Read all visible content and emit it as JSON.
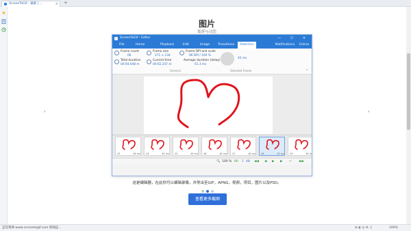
{
  "browser": {
    "tab_title": "ScreenToGif - 录屏 | ...",
    "tab_close": "×",
    "new_tab": "+"
  },
  "sidebar": {
    "icons": [
      "star-icon",
      "page-icon",
      "history-icon"
    ]
  },
  "page": {
    "title": "图片",
    "subtitle": "截屏与动图",
    "prev_arrow": "‹",
    "next_arrow": "›",
    "caption": "这是编辑器，在此你可以编辑录像，并导出至GIF，APNG，视频，项目，图片以及PSD。",
    "dots": [
      false,
      true,
      false
    ],
    "more_button": "查看更多截图"
  },
  "editor": {
    "window_title": "ScreenToGif - Editor",
    "window_buttons": [
      "—",
      "☐",
      "✕"
    ],
    "tabs": [
      "File",
      "Home",
      "Playback",
      "Edit",
      "Image",
      "Transitions",
      "Statistics"
    ],
    "right_tabs": [
      "Notifications",
      "Extras"
    ],
    "active_tab": "Statistics",
    "stats": {
      "frame_count_label": "Frame count",
      "frame_count": "66",
      "total_duration_label": "Total duration",
      "total_duration": "00:04.048 m",
      "frame_size_label": "Frame size",
      "frame_size": "271 × 234",
      "current_time_label": "Current time",
      "current_time": "00:02.247 m",
      "frame_dpi_label": "Frame DPI and scale",
      "frame_dpi": "96 DPI / 100 %",
      "avg_duration_label": "Average duration (delay)",
      "avg_duration": "61.3 ms",
      "selected_delay": "45 ms",
      "group_general": "General",
      "group_selected": "Selected Frame"
    },
    "frames": [
      {
        "index": "43",
        "delay": "46 ms",
        "selected": false
      },
      {
        "index": "44",
        "delay": "45 ms",
        "selected": false
      },
      {
        "index": "45",
        "delay": "46 ms",
        "selected": false
      },
      {
        "index": "46",
        "delay": "46 ms",
        "selected": false
      },
      {
        "index": "47",
        "delay": "46 ms",
        "selected": false
      },
      {
        "index": "48",
        "delay": "45 ms",
        "selected": true
      },
      {
        "index": "49",
        "delay": "46 ms",
        "selected": false
      }
    ],
    "statusbar": {
      "zoom": "100",
      "zoom_unit": "%",
      "current_frame": "66",
      "frame_sep": "1",
      "frame_total": "48"
    },
    "heart_color": "#e0141b",
    "accent_color": "#2b7bd6"
  },
  "statusbar": {
    "left_text": "正在等待 www.screentogif.com 的响应...",
    "zoom": "100%"
  }
}
